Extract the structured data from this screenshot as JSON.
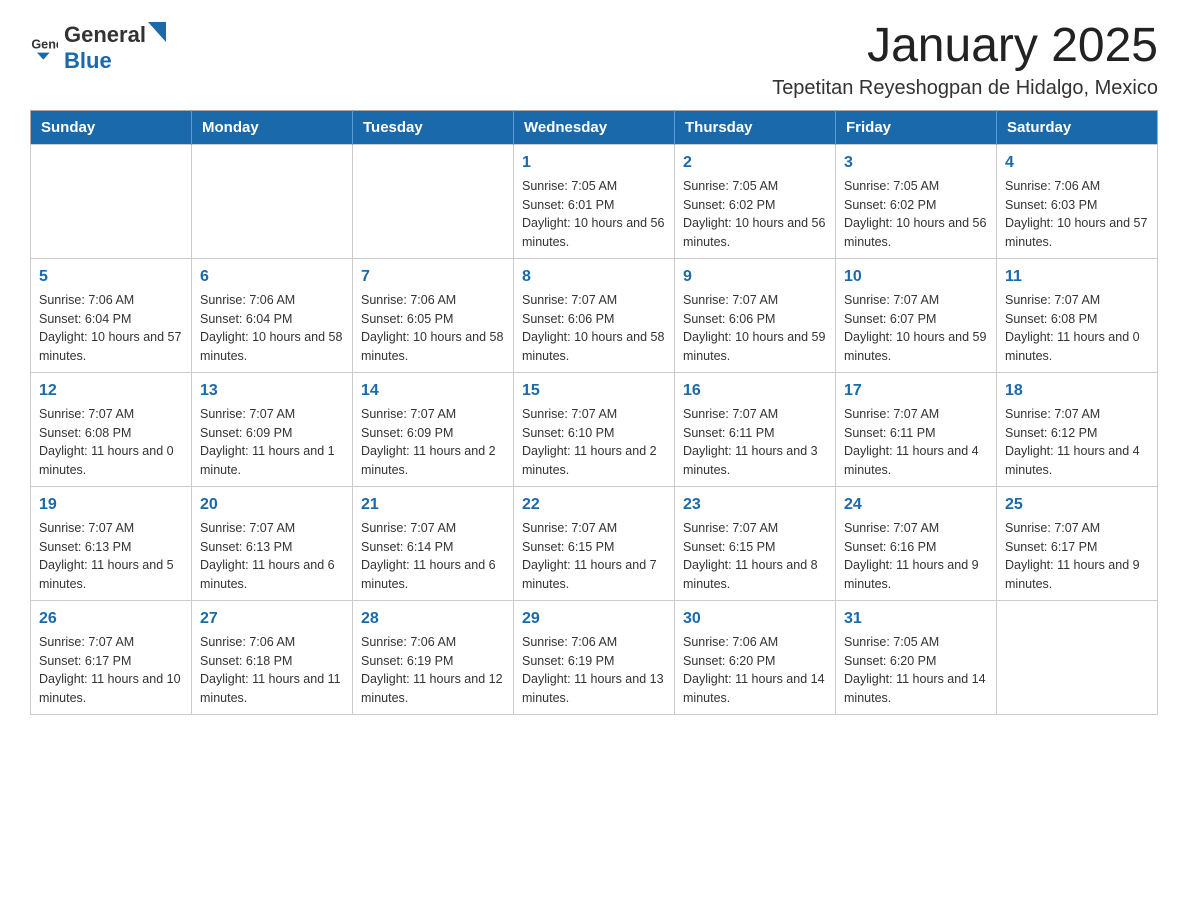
{
  "header": {
    "logo": {
      "general": "General",
      "blue": "Blue"
    },
    "title": "January 2025",
    "location": "Tepetitan Reyeshogpan de Hidalgo, Mexico"
  },
  "calendar": {
    "days_of_week": [
      "Sunday",
      "Monday",
      "Tuesday",
      "Wednesday",
      "Thursday",
      "Friday",
      "Saturday"
    ],
    "weeks": [
      [
        {
          "day": "",
          "info": ""
        },
        {
          "day": "",
          "info": ""
        },
        {
          "day": "",
          "info": ""
        },
        {
          "day": "1",
          "info": "Sunrise: 7:05 AM\nSunset: 6:01 PM\nDaylight: 10 hours and 56 minutes."
        },
        {
          "day": "2",
          "info": "Sunrise: 7:05 AM\nSunset: 6:02 PM\nDaylight: 10 hours and 56 minutes."
        },
        {
          "day": "3",
          "info": "Sunrise: 7:05 AM\nSunset: 6:02 PM\nDaylight: 10 hours and 56 minutes."
        },
        {
          "day": "4",
          "info": "Sunrise: 7:06 AM\nSunset: 6:03 PM\nDaylight: 10 hours and 57 minutes."
        }
      ],
      [
        {
          "day": "5",
          "info": "Sunrise: 7:06 AM\nSunset: 6:04 PM\nDaylight: 10 hours and 57 minutes."
        },
        {
          "day": "6",
          "info": "Sunrise: 7:06 AM\nSunset: 6:04 PM\nDaylight: 10 hours and 58 minutes."
        },
        {
          "day": "7",
          "info": "Sunrise: 7:06 AM\nSunset: 6:05 PM\nDaylight: 10 hours and 58 minutes."
        },
        {
          "day": "8",
          "info": "Sunrise: 7:07 AM\nSunset: 6:06 PM\nDaylight: 10 hours and 58 minutes."
        },
        {
          "day": "9",
          "info": "Sunrise: 7:07 AM\nSunset: 6:06 PM\nDaylight: 10 hours and 59 minutes."
        },
        {
          "day": "10",
          "info": "Sunrise: 7:07 AM\nSunset: 6:07 PM\nDaylight: 10 hours and 59 minutes."
        },
        {
          "day": "11",
          "info": "Sunrise: 7:07 AM\nSunset: 6:08 PM\nDaylight: 11 hours and 0 minutes."
        }
      ],
      [
        {
          "day": "12",
          "info": "Sunrise: 7:07 AM\nSunset: 6:08 PM\nDaylight: 11 hours and 0 minutes."
        },
        {
          "day": "13",
          "info": "Sunrise: 7:07 AM\nSunset: 6:09 PM\nDaylight: 11 hours and 1 minute."
        },
        {
          "day": "14",
          "info": "Sunrise: 7:07 AM\nSunset: 6:09 PM\nDaylight: 11 hours and 2 minutes."
        },
        {
          "day": "15",
          "info": "Sunrise: 7:07 AM\nSunset: 6:10 PM\nDaylight: 11 hours and 2 minutes."
        },
        {
          "day": "16",
          "info": "Sunrise: 7:07 AM\nSunset: 6:11 PM\nDaylight: 11 hours and 3 minutes."
        },
        {
          "day": "17",
          "info": "Sunrise: 7:07 AM\nSunset: 6:11 PM\nDaylight: 11 hours and 4 minutes."
        },
        {
          "day": "18",
          "info": "Sunrise: 7:07 AM\nSunset: 6:12 PM\nDaylight: 11 hours and 4 minutes."
        }
      ],
      [
        {
          "day": "19",
          "info": "Sunrise: 7:07 AM\nSunset: 6:13 PM\nDaylight: 11 hours and 5 minutes."
        },
        {
          "day": "20",
          "info": "Sunrise: 7:07 AM\nSunset: 6:13 PM\nDaylight: 11 hours and 6 minutes."
        },
        {
          "day": "21",
          "info": "Sunrise: 7:07 AM\nSunset: 6:14 PM\nDaylight: 11 hours and 6 minutes."
        },
        {
          "day": "22",
          "info": "Sunrise: 7:07 AM\nSunset: 6:15 PM\nDaylight: 11 hours and 7 minutes."
        },
        {
          "day": "23",
          "info": "Sunrise: 7:07 AM\nSunset: 6:15 PM\nDaylight: 11 hours and 8 minutes."
        },
        {
          "day": "24",
          "info": "Sunrise: 7:07 AM\nSunset: 6:16 PM\nDaylight: 11 hours and 9 minutes."
        },
        {
          "day": "25",
          "info": "Sunrise: 7:07 AM\nSunset: 6:17 PM\nDaylight: 11 hours and 9 minutes."
        }
      ],
      [
        {
          "day": "26",
          "info": "Sunrise: 7:07 AM\nSunset: 6:17 PM\nDaylight: 11 hours and 10 minutes."
        },
        {
          "day": "27",
          "info": "Sunrise: 7:06 AM\nSunset: 6:18 PM\nDaylight: 11 hours and 11 minutes."
        },
        {
          "day": "28",
          "info": "Sunrise: 7:06 AM\nSunset: 6:19 PM\nDaylight: 11 hours and 12 minutes."
        },
        {
          "day": "29",
          "info": "Sunrise: 7:06 AM\nSunset: 6:19 PM\nDaylight: 11 hours and 13 minutes."
        },
        {
          "day": "30",
          "info": "Sunrise: 7:06 AM\nSunset: 6:20 PM\nDaylight: 11 hours and 14 minutes."
        },
        {
          "day": "31",
          "info": "Sunrise: 7:05 AM\nSunset: 6:20 PM\nDaylight: 11 hours and 14 minutes."
        },
        {
          "day": "",
          "info": ""
        }
      ]
    ]
  }
}
